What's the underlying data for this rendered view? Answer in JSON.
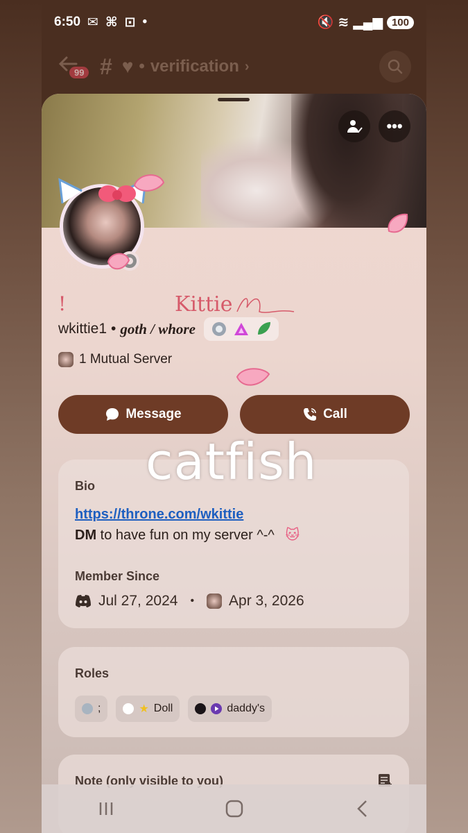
{
  "status": {
    "time": "6:50",
    "battery": "100",
    "network": "6"
  },
  "channel": {
    "badge": "99",
    "name": "verification",
    "prefix": "#"
  },
  "profile": {
    "display_prefix": "!",
    "display_name": "Kittie",
    "username": "wkittie1",
    "separator": "•",
    "tagline": "goth / whore",
    "mutual_servers": "1 Mutual Server"
  },
  "actions": {
    "message_label": "Message",
    "call_label": "Call"
  },
  "overlay": {
    "text": "catfish"
  },
  "bio": {
    "title": "Bio",
    "link": "https://throne.com/wkittie",
    "text_bold": "DM",
    "text_rest": " to have fun on my server ^-^"
  },
  "member_since": {
    "title": "Member Since",
    "discord_date": "Jul 27, 2024",
    "separator": "•",
    "server_date": "Apr 3, 2026"
  },
  "roles": {
    "title": "Roles",
    "items": [
      {
        "label": ";",
        "color": "#a8b4c0"
      },
      {
        "label": "Doll",
        "color": "#ffffff"
      },
      {
        "label": "daddy's",
        "color": "#1a1418"
      }
    ]
  },
  "note": {
    "title": "Note (only visible to you)"
  },
  "colors": {
    "accent": "#6e3b26",
    "name_pink": "#d65a6a",
    "link_blue": "#1e5fc0"
  },
  "icons": [
    "back-arrow-icon",
    "hash-icon",
    "heart-icon",
    "chevron-right-icon",
    "search-icon",
    "add-friend-icon",
    "more-icon",
    "message-icon",
    "call-icon",
    "discord-icon",
    "note-icon"
  ]
}
